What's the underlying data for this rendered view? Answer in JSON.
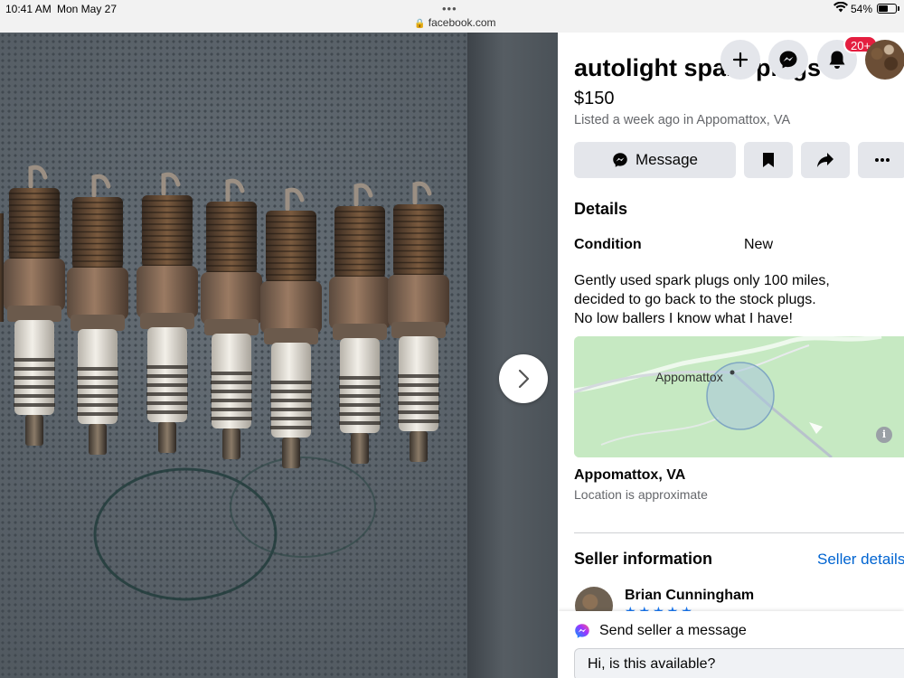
{
  "status_bar": {
    "time": "10:41 AM",
    "date": "Mon May 27",
    "url": "facebook.com",
    "battery": "54%",
    "battery_level": 0.54
  },
  "header": {
    "notification_badge": "20+"
  },
  "listing": {
    "title": "autolight spark plugs",
    "price": "$150",
    "listed": "Listed a week ago in Appomattox, VA",
    "description_lines": [
      "Gently used spark plugs only 100 miles,",
      "decided to go back to the stock plugs.",
      "No low ballers I know what I have!"
    ]
  },
  "actions": {
    "message_label": "Message"
  },
  "details": {
    "title": "Details",
    "condition_label": "Condition",
    "condition_value": "New"
  },
  "map": {
    "label": "Appomattox",
    "info": "i"
  },
  "location": {
    "city": "Appomattox, VA",
    "note": "Location is approximate"
  },
  "seller": {
    "section_title": "Seller information",
    "details_link": "Seller details",
    "name": "Brian Cunningham"
  },
  "message_box": {
    "title": "Send seller a message",
    "input_value": "Hi, is this available?"
  },
  "colors": {
    "accent": "#1877f2",
    "link": "#0064d1",
    "badge": "#e41e3f",
    "button_bg": "#e4e6eb"
  }
}
